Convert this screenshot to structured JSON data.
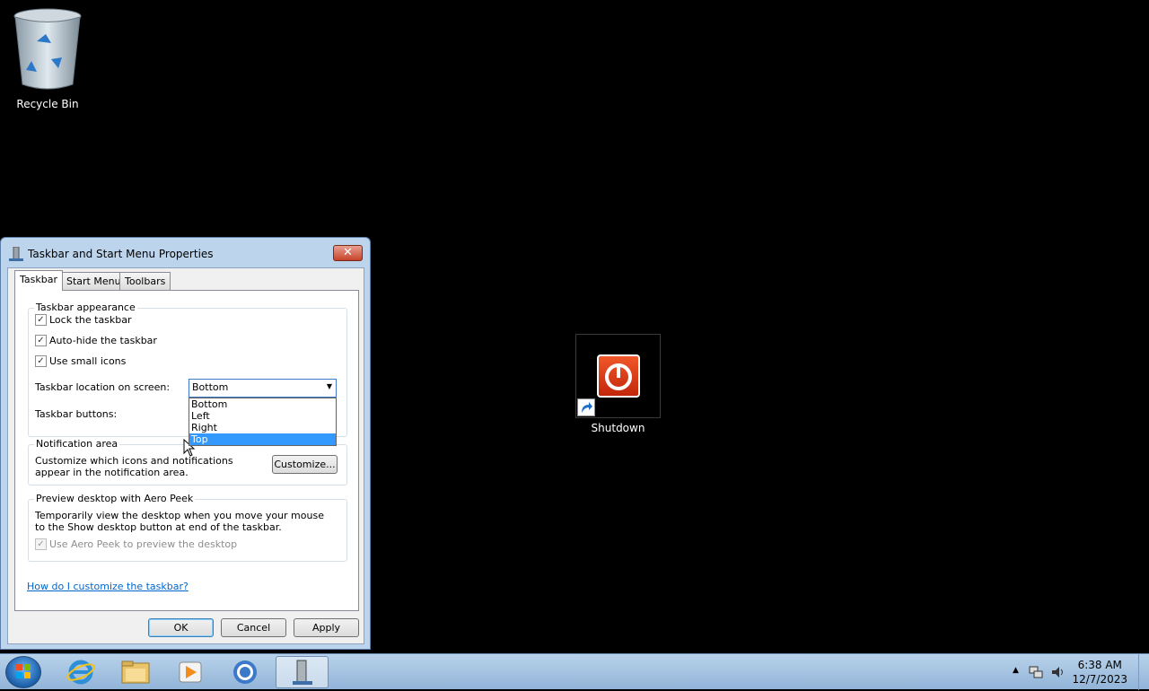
{
  "desktop": {
    "recycle_bin_label": "Recycle Bin",
    "shutdown_label": "Shutdown"
  },
  "dialog": {
    "title": "Taskbar and Start Menu Properties",
    "close_glyph": "✕",
    "tabs": [
      {
        "label": "Taskbar",
        "active": true
      },
      {
        "label": "Start Menu",
        "active": false
      },
      {
        "label": "Toolbars",
        "active": false
      }
    ],
    "appearance": {
      "group_title": "Taskbar appearance",
      "lock_taskbar": "Lock the taskbar",
      "auto_hide": "Auto-hide the taskbar",
      "small_icons": "Use small icons",
      "location_label": "Taskbar location on screen:",
      "location_value": "Bottom",
      "location_options": [
        "Bottom",
        "Left",
        "Right",
        "Top"
      ],
      "highlighted_option": "Top",
      "buttons_label": "Taskbar buttons:"
    },
    "notification": {
      "group_title": "Notification area",
      "description": "Customize which icons and notifications appear in the notification area.",
      "customize_button": "Customize..."
    },
    "aero_peek": {
      "group_title": "Preview desktop with Aero Peek",
      "description": "Temporarily view the desktop when you move your mouse to the Show desktop button at end of the taskbar.",
      "checkbox": "Use Aero Peek to preview the desktop"
    },
    "help_link": "How do I customize the taskbar?",
    "ok_button": "OK",
    "cancel_button": "Cancel",
    "apply_button": "Apply"
  },
  "taskbar": {
    "apps": [
      "internet-explorer",
      "windows-explorer",
      "media-player",
      "chrome",
      "taskbar-properties"
    ],
    "clock_time": "6:38 AM",
    "clock_date": "12/7/2023"
  }
}
